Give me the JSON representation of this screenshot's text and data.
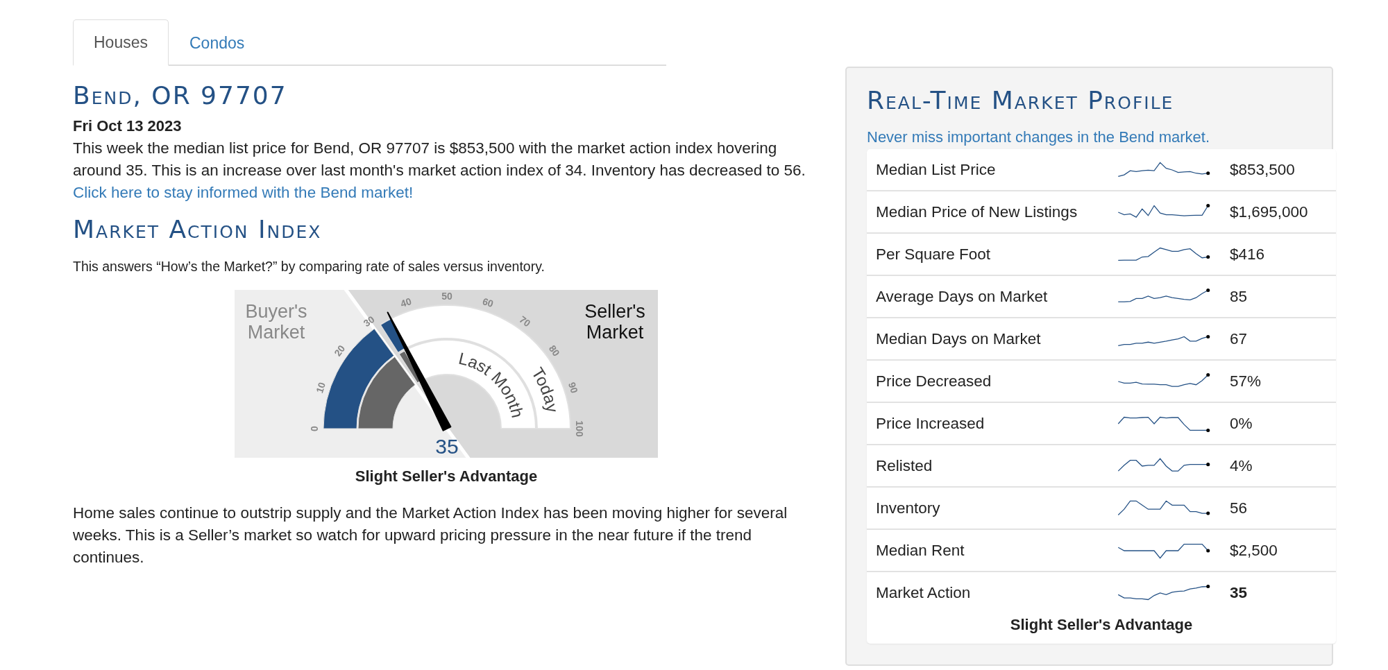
{
  "tabs": [
    {
      "label": "Houses",
      "selected": true
    },
    {
      "label": "Condos",
      "selected": false
    }
  ],
  "location_title": "Bend, OR 97707",
  "date": "Fri Oct 13 2023",
  "summary": "This week the median list price for Bend, OR 97707 is $853,500 with the market action index hovering around 35. This is an increase over last month's market action index of 34. Inventory has decreased to 56.",
  "summary_link": "Click here to stay informed with the Bend market!",
  "index_section": {
    "title": "Market Action Index",
    "description": "This answers “How’s the Market?” by comparing rate of sales versus inventory.",
    "gauge": {
      "buyer_label": [
        "Buyer's",
        "Market"
      ],
      "seller_label": [
        "Seller's",
        "Market"
      ],
      "ticks": [
        "0",
        "10",
        "20",
        "30",
        "40",
        "50",
        "60",
        "70",
        "80",
        "90",
        "100"
      ],
      "arcs": [
        {
          "label": "Last Month",
          "level": 0.34
        },
        {
          "label": "Today",
          "level": 0.35
        }
      ],
      "reading": "35"
    },
    "caption": "Slight Seller's Advantage",
    "commentary": "Home sales continue to outstrip supply and the Market Action Index has been moving higher for several weeks. This is a Seller’s market so watch for upward pricing pressure in the near future if the trend continues."
  },
  "profile": {
    "title": "Real-Time Market Profile",
    "subtitle": "Never miss important changes in the Bend market.",
    "rows": [
      {
        "label": "Median List Price",
        "value": "$853,500",
        "highlighted": false
      },
      {
        "label": "Median Price of New Listings",
        "value": "$1,695,000",
        "highlighted": false
      },
      {
        "label": "Per Square Foot",
        "value": "$416",
        "highlighted": false
      },
      {
        "label": "Average Days on Market",
        "value": "85",
        "highlighted": false
      },
      {
        "label": "Median Days on Market",
        "value": "67",
        "highlighted": false
      },
      {
        "label": "Price Decreased",
        "value": "57%",
        "highlighted": false
      },
      {
        "label": "Price Increased",
        "value": "0%",
        "highlighted": false
      },
      {
        "label": "Relisted",
        "value": "4%",
        "highlighted": false
      },
      {
        "label": "Inventory",
        "value": "56",
        "highlighted": false
      },
      {
        "label": "Median Rent",
        "value": "$2,500",
        "highlighted": false
      },
      {
        "label": "Market Action",
        "value": "35",
        "highlighted": true
      }
    ],
    "caption": "Slight Seller's Advantage"
  }
}
